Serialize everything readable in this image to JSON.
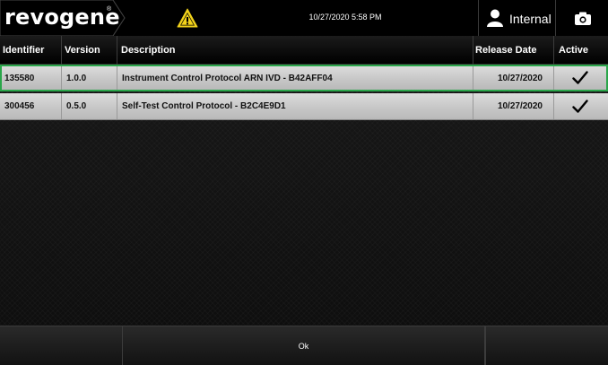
{
  "header": {
    "logo": "revogene",
    "logo_mark": "®",
    "warning_icon": "warning-triangle-icon",
    "datetime": "10/27/2020 5:58 PM",
    "user_label": "Internal",
    "user_icon": "user-icon",
    "camera_icon": "camera-icon"
  },
  "colors": {
    "accent_warning": "#f2d21b",
    "selection_outline": "#2aa64a",
    "row_bg": "#cfcfcf",
    "bar_bg": "#000000"
  },
  "table": {
    "columns": [
      "Identifier",
      "Version",
      "Description",
      "Release Date",
      "Active"
    ],
    "rows": [
      {
        "identifier": "135580",
        "version": "1.0.0",
        "description": "Instrument Control Protocol ARN IVD - B42AFF04",
        "release_date": "10/27/2020",
        "active": "check-icon",
        "selected": true
      },
      {
        "identifier": "300456",
        "version": "0.5.0",
        "description": "Self-Test Control Protocol - B2C4E9D1",
        "release_date": "10/27/2020",
        "active": "check-icon",
        "selected": false
      }
    ]
  },
  "footer": {
    "ok_label": "Ok"
  }
}
